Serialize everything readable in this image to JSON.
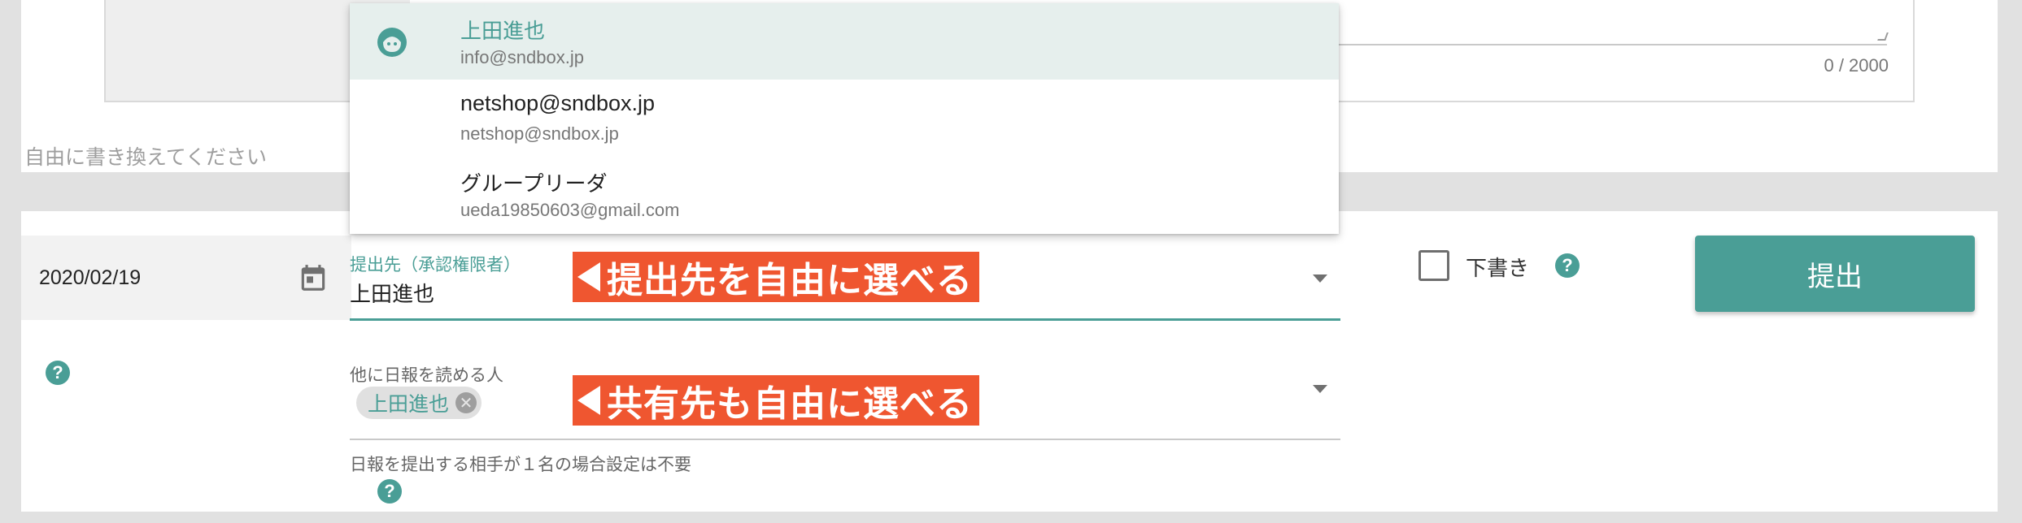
{
  "top": {
    "counter": "0 / 2000",
    "hint": "自由に書き換えてください"
  },
  "form": {
    "date": "2020/02/19",
    "submit_to_label": "提出先（承認権限者）",
    "submit_to_value": "上田進也",
    "callout_submit": "提出先を自由に選べる",
    "callout_share": "共有先も自由に選べる",
    "draft_label": "下書き",
    "submit_button": "提出",
    "share_label": "他に日報を読める人",
    "share_chip": "上田進也",
    "share_hint": "日報を提出する相手が１名の場合設定は不要",
    "help_glyph": "?",
    "chip_close_glyph": "✕"
  },
  "dropdown": {
    "items": [
      {
        "name": "上田進也",
        "email": "info@sndbox.jp"
      },
      {
        "name": "netshop@sndbox.jp",
        "email": "netshop@sndbox.jp"
      },
      {
        "name": "グループリーダ",
        "email": "ueda19850603@gmail.com"
      }
    ]
  },
  "colors": {
    "accent": "#4a9e96",
    "callout": "#ef5630",
    "selected_row": "#e6efed"
  },
  "icons": [
    "calendar-icon",
    "help-icon",
    "dropdown-arrow-icon",
    "avatar-icon",
    "chip-close-icon"
  ]
}
